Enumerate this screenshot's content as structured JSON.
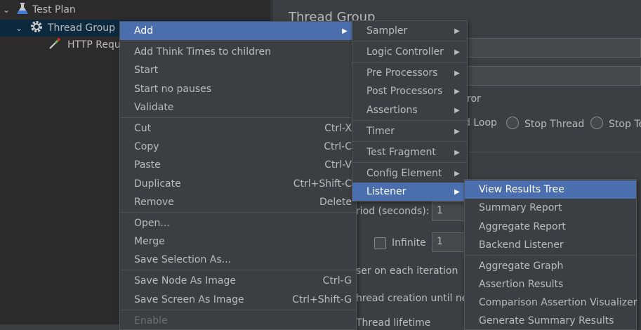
{
  "tree": {
    "test_plan": "Test Plan",
    "thread_group": "Thread Group",
    "http_request": "HTTP Requ"
  },
  "panel": {
    "title": "Thread Group",
    "error_action_partial": "ror",
    "radio_loop": "d Loop",
    "radio_stop_thread": "Stop Thread",
    "radio_stop_test": "Stop Te",
    "ramp_label": "riod (seconds):",
    "ramp_value": "1",
    "infinite_label": "Infinite",
    "loop_value": "1",
    "same_user_text": "ser on each iteration",
    "delay_text": "hread creation until nee",
    "lifetime_text": "Thread lifetime"
  },
  "context_menu": {
    "add": "Add",
    "add_think_times": "Add Think Times to children",
    "start": "Start",
    "start_no_pauses": "Start no pauses",
    "validate": "Validate",
    "cut": "Cut",
    "cut_sc": "Ctrl-X",
    "copy": "Copy",
    "copy_sc": "Ctrl-C",
    "paste": "Paste",
    "paste_sc": "Ctrl-V",
    "duplicate": "Duplicate",
    "duplicate_sc": "Ctrl+Shift-C",
    "remove": "Remove",
    "remove_sc": "Delete",
    "open": "Open...",
    "merge": "Merge",
    "save_selection": "Save Selection As...",
    "save_node_image": "Save Node As Image",
    "save_node_image_sc": "Ctrl-G",
    "save_screen_image": "Save Screen As Image",
    "save_screen_image_sc": "Ctrl+Shift-G",
    "enable": "Enable"
  },
  "add_menu": {
    "sampler": "Sampler",
    "logic_controller": "Logic Controller",
    "pre_processors": "Pre Processors",
    "post_processors": "Post Processors",
    "assertions": "Assertions",
    "timer": "Timer",
    "test_fragment": "Test Fragment",
    "config_element": "Config Element",
    "listener": "Listener"
  },
  "listener_menu": {
    "view_results_tree": "View Results Tree",
    "summary_report": "Summary Report",
    "aggregate_report": "Aggregate Report",
    "backend_listener": "Backend Listener",
    "aggregate_graph": "Aggregate Graph",
    "assertion_results": "Assertion Results",
    "comparison_assertion_visualizer": "Comparison Assertion Visualizer",
    "generate_summary_results": "Generate Summary Results"
  },
  "colors": {
    "menu_bg": "#3c3f41",
    "highlight": "#4b6eaf",
    "tree_bg": "#2b2b2b",
    "tree_selected": "#0d293e"
  }
}
